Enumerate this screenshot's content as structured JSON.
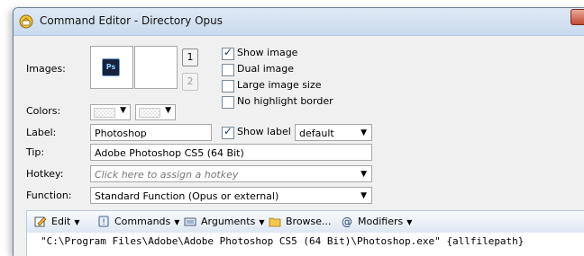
{
  "window": {
    "title": "Command Editor - Directory Opus"
  },
  "images": {
    "label": "Images:",
    "icon1_text": "Ps",
    "num1": "1",
    "num2": "2"
  },
  "options": {
    "show_image": "Show image",
    "dual_image": "Dual image",
    "large_image_size": "Large image size",
    "no_highlight_border": "No highlight border",
    "show_label": "Show label"
  },
  "colors": {
    "label": "Colors:"
  },
  "label_field": {
    "label": "Label:",
    "value": "Photoshop",
    "style_value": "default"
  },
  "tip_field": {
    "label": "Tip:",
    "value": "Adobe Photoshop CS5 (64 Bit)"
  },
  "hotkey_field": {
    "label": "Hotkey:",
    "placeholder": "Click here to assign a hotkey"
  },
  "function_field": {
    "label": "Function:",
    "value": "Standard Function (Opus or external)"
  },
  "toolbar": {
    "edit": "Edit",
    "commands": "Commands",
    "arguments": "Arguments",
    "browse": "Browse...",
    "modifiers": "Modifiers"
  },
  "editor": {
    "line1": "\"C:\\Program Files\\Adobe\\Adobe Photoshop CS5 (64 Bit)\\Photoshop.exe\" {allfilepath}"
  },
  "colors_accent": {
    "titlebar": "#c9daee",
    "content_bg": "#f0f0f0"
  }
}
